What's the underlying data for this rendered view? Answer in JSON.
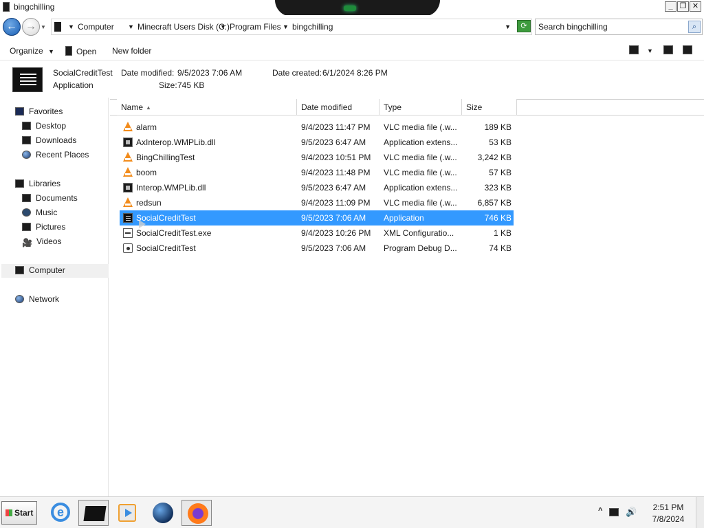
{
  "window": {
    "title": "bingchilling",
    "minimize_label": "_",
    "restore_label": "❐",
    "close_label": "✕"
  },
  "address": {
    "back_glyph": "←",
    "forward_glyph": "→",
    "crumbs": [
      "Computer",
      "Minecraft Users Disk (C:)",
      "Program Files",
      "bingchilling"
    ],
    "refresh_glyph": "⟳"
  },
  "search": {
    "value": "Search bingchilling",
    "icon_glyph": "⌕"
  },
  "toolbar": {
    "organize_label": "Organize",
    "open_label": "Open",
    "new_folder_label": "New folder"
  },
  "details": {
    "name": "SocialCreditTest",
    "type": "Application",
    "date_modified_label": "Date modified:",
    "date_modified": "9/5/2023 7:06 AM",
    "date_created_label": "Date created:",
    "date_created": "6/1/2024 8:26 PM",
    "size_label": "Size:",
    "size": "745 KB"
  },
  "nav": {
    "favorites": "Favorites",
    "desktop": "Desktop",
    "downloads": "Downloads",
    "recent_places": "Recent Places",
    "libraries": "Libraries",
    "documents": "Documents",
    "music": "Music",
    "pictures": "Pictures",
    "videos": "Videos",
    "computer": "Computer",
    "network": "Network"
  },
  "columns": {
    "name": "Name",
    "date_modified": "Date modified",
    "type": "Type",
    "size": "Size"
  },
  "files": [
    {
      "icon": "vlc-icon",
      "name": "alarm",
      "date": "9/4/2023 11:47 PM",
      "type": "VLC media file (.w...",
      "size": "189 KB"
    },
    {
      "icon": "dll-icon",
      "name": "AxInterop.WMPLib.dll",
      "date": "9/5/2023 6:47 AM",
      "type": "Application extens...",
      "size": "53 KB"
    },
    {
      "icon": "vlc-icon",
      "name": "BingChillingTest",
      "date": "9/4/2023 10:51 PM",
      "type": "VLC media file (.w...",
      "size": "3,242 KB"
    },
    {
      "icon": "vlc-icon",
      "name": "boom",
      "date": "9/4/2023 11:48 PM",
      "type": "VLC media file (.w...",
      "size": "57 KB"
    },
    {
      "icon": "dll-icon",
      "name": "Interop.WMPLib.dll",
      "date": "9/5/2023 6:47 AM",
      "type": "Application extens...",
      "size": "323 KB"
    },
    {
      "icon": "vlc-icon",
      "name": "redsun",
      "date": "9/4/2023 11:09 PM",
      "type": "VLC media file (.w...",
      "size": "6,857 KB"
    },
    {
      "icon": "app-icon",
      "name": "SocialCreditTest",
      "date": "9/5/2023 7:06 AM",
      "type": "Application",
      "size": "746 KB"
    },
    {
      "icon": "config-icon",
      "name": "SocialCreditTest.exe",
      "date": "9/4/2023 10:26 PM",
      "type": "XML Configuratio...",
      "size": "1 KB"
    },
    {
      "icon": "debug-icon",
      "name": "SocialCreditTest",
      "date": "9/5/2023 7:06 AM",
      "type": "Program Debug D...",
      "size": "74 KB"
    }
  ],
  "selected_index": 6,
  "taskbar": {
    "start_label": "Start",
    "time": "2:51 PM",
    "date": "7/8/2024",
    "tray_chevron": "^"
  },
  "colors": {
    "selection": "#3399ff",
    "vlc_orange": "#f28c1c"
  }
}
